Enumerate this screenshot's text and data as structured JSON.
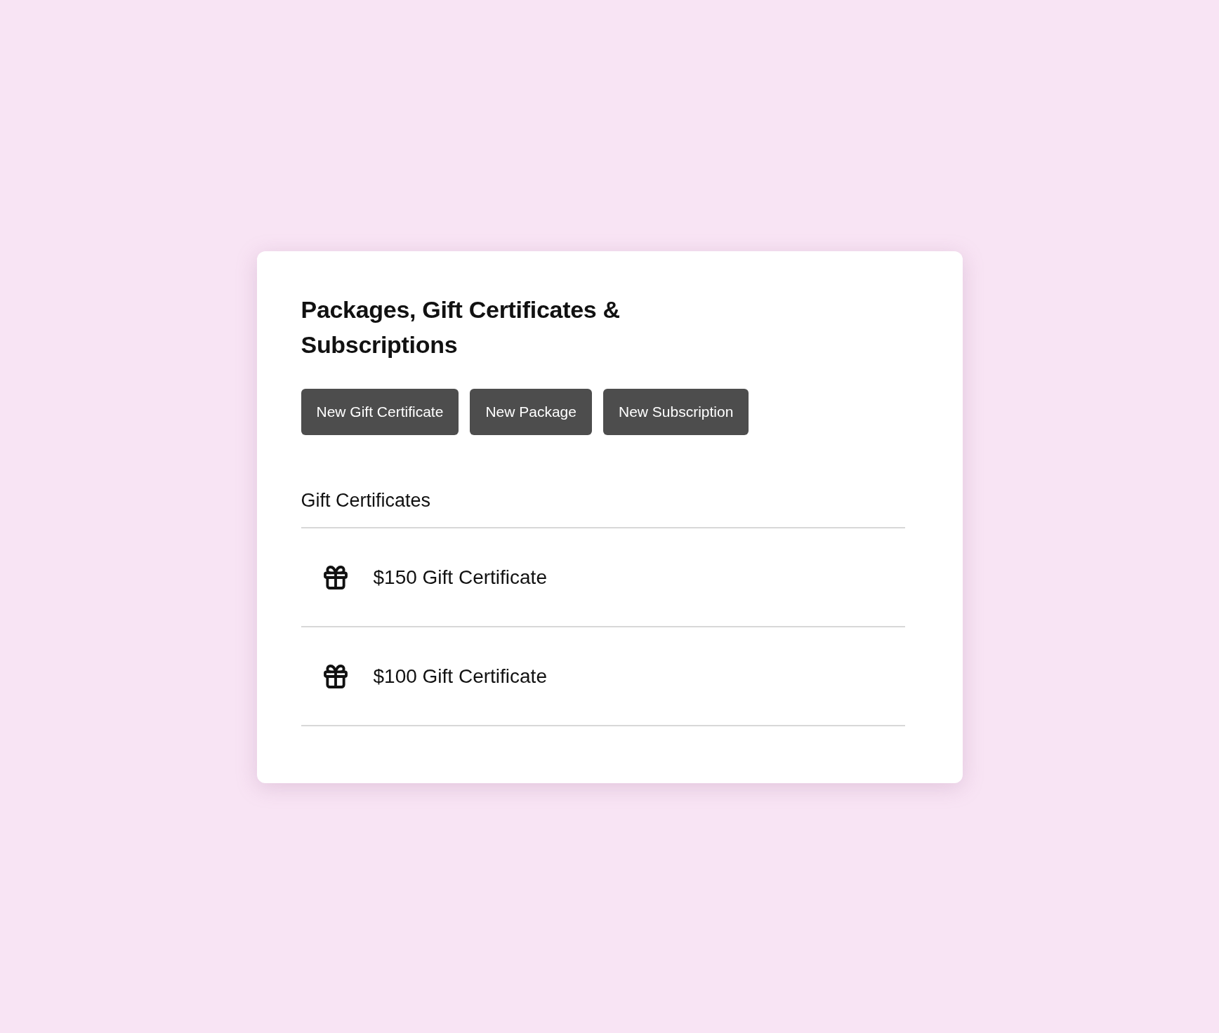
{
  "title": "Packages, Gift Certificates & Subscriptions",
  "buttons": [
    "New Gift Certificate",
    "New Package",
    "New Subscription"
  ],
  "section": {
    "title": "Gift Certificates",
    "items": [
      {
        "kind": "gift",
        "label": "$150 Gift Certificate"
      },
      {
        "kind": "gift",
        "label": "$100 Gift Certificate"
      }
    ]
  }
}
